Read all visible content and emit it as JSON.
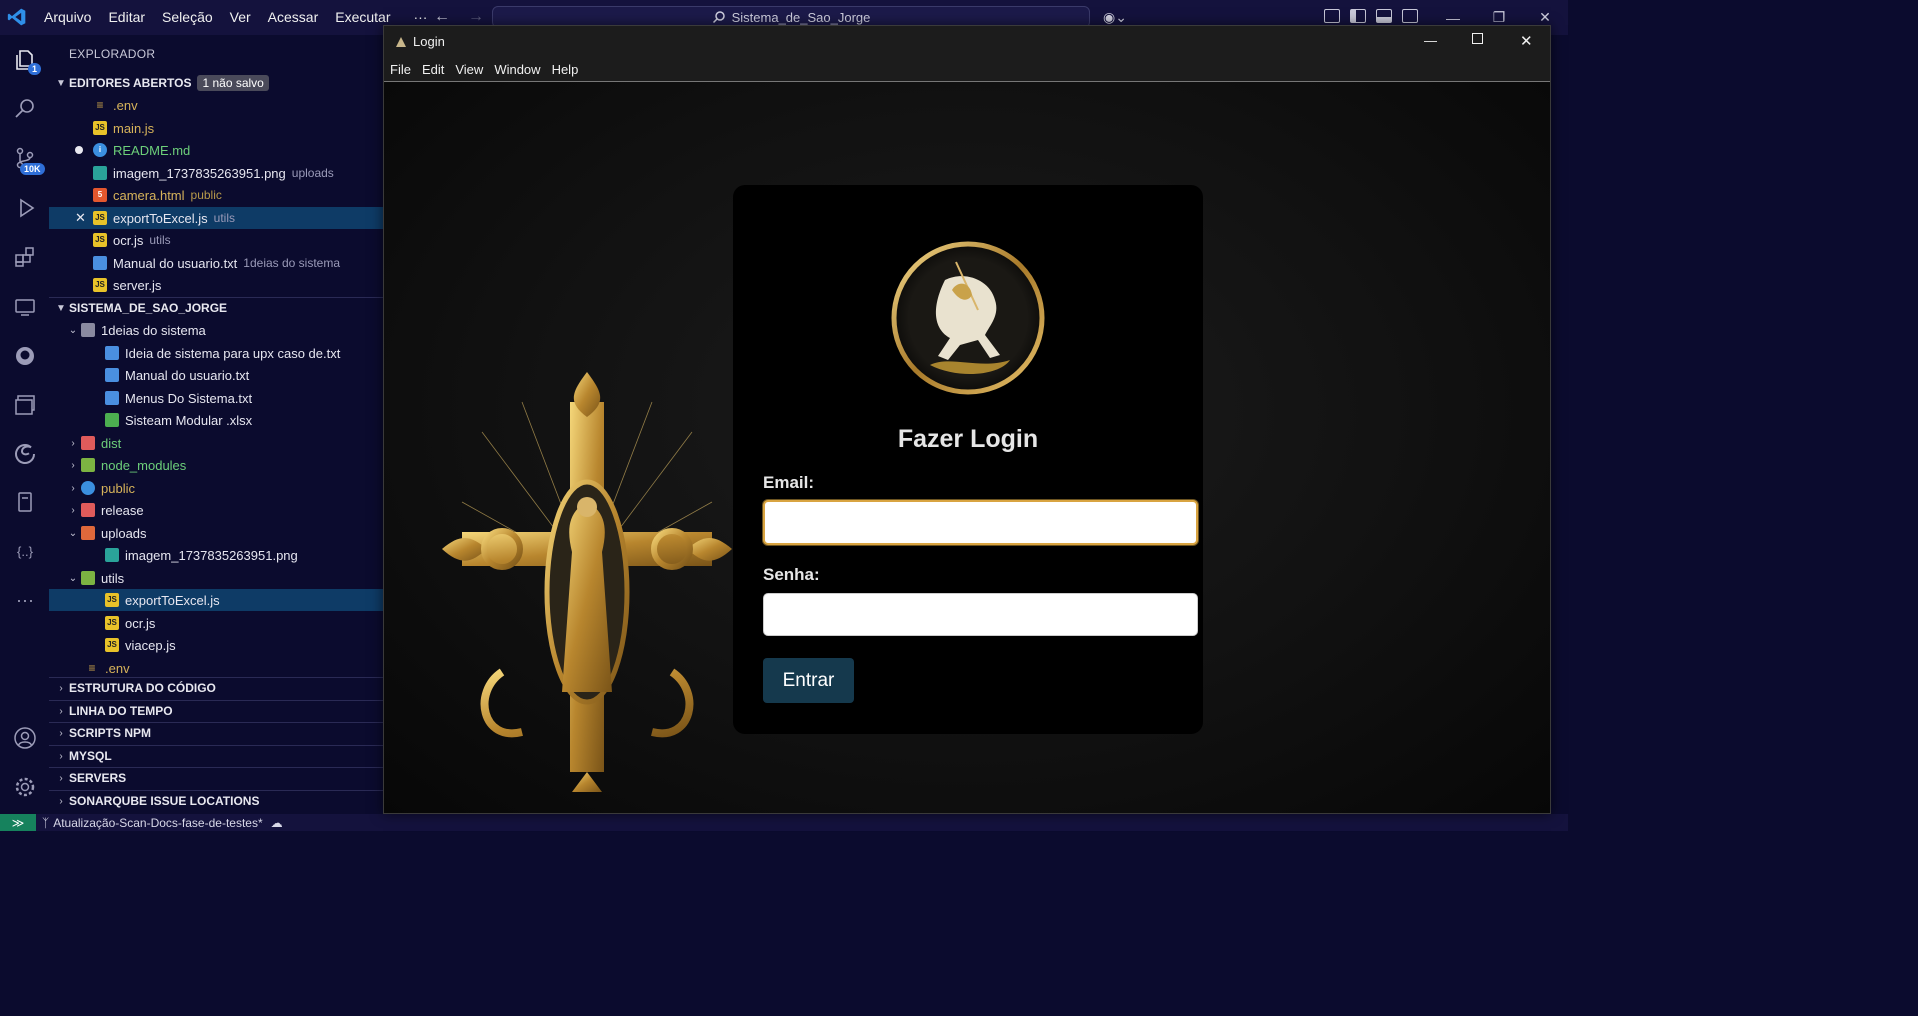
{
  "titlebar": {
    "menu": [
      "Arquivo",
      "Editar",
      "Seleção",
      "Ver",
      "Acessar",
      "Executar",
      "···"
    ],
    "search_text": "Sistema_de_Sao_Jorge"
  },
  "activity": {
    "explorer_badge": "1",
    "scm_badge": "10K"
  },
  "sidebar": {
    "title": "EXPLORADOR",
    "open_editors_label": "EDITORES ABERTOS",
    "unsaved_chip": "1 não salvo",
    "open_editors": [
      {
        "name": ".env",
        "desc": ""
      },
      {
        "name": "main.js",
        "desc": ""
      },
      {
        "name": "README.md",
        "desc": ""
      },
      {
        "name": "imagem_1737835263951.png",
        "desc": "uploads"
      },
      {
        "name": "camera.html",
        "desc": "public"
      },
      {
        "name": "exportToExcel.js",
        "desc": "utils"
      },
      {
        "name": "ocr.js",
        "desc": "utils"
      },
      {
        "name": "Manual do usuario.txt",
        "desc": "1deias do sistema"
      },
      {
        "name": "server.js",
        "desc": ""
      }
    ],
    "project_label": "SISTEMA_DE_SAO_JORGE",
    "tree": [
      "1deias do sistema",
      "Ideia de sistema para upx caso de.txt",
      "Manual do usuario.txt",
      "Menus Do Sistema.txt",
      "Sisteam Modular .xlsx",
      "dist",
      "node_modules",
      "public",
      "release",
      "uploads",
      "imagem_1737835263951.png",
      "utils",
      "exportToExcel.js",
      "ocr.js",
      "viacep.js",
      ".env"
    ],
    "sections": [
      "ESTRUTURA DO CÓDIGO",
      "LINHA DO TEMPO",
      "SCRIPTS NPM",
      "MYSQL",
      "SERVERS",
      "SONARQUBE ISSUE LOCATIONS"
    ]
  },
  "statusbar": {
    "branch": "Atualização-Scan-Docs-fase-de-testes*"
  },
  "app": {
    "title": "Login",
    "menu": [
      "File",
      "Edit",
      "View",
      "Window",
      "Help"
    ],
    "heading": "Fazer Login",
    "email_label": "Email:",
    "password_label": "Senha:",
    "submit_label": "Entrar"
  }
}
